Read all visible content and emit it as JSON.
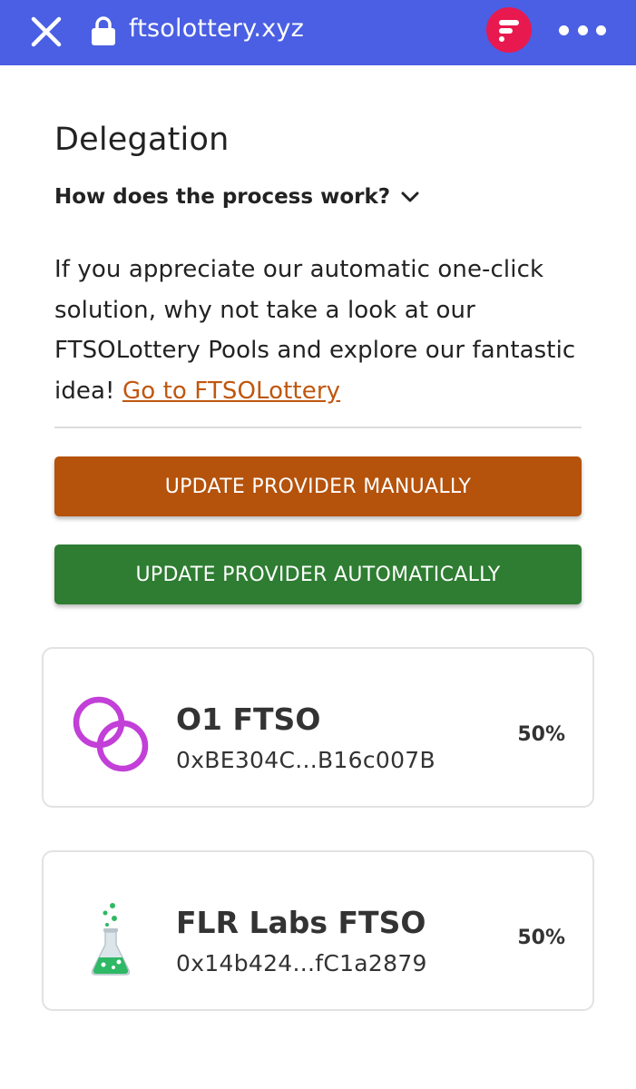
{
  "browser": {
    "url": "ftsolottery.xyz",
    "close_icon": "close-icon",
    "lock_icon": "lock-icon",
    "app_logo_icon": "flare-logo-icon",
    "more_icon": "more-dots-icon"
  },
  "page": {
    "title": "Delegation",
    "faq_label": "How does the process work?",
    "description": "If you appreciate our automatic one-click solution, why not take a look at our FTSOLottery Pools and explore our fantastic idea!",
    "link_text": "Go to FTSOLottery"
  },
  "buttons": {
    "manual_label": "UPDATE PROVIDER MANUALLY",
    "auto_label": "UPDATE PROVIDER AUTOMATICALLY"
  },
  "providers": [
    {
      "name": "O1 FTSO",
      "address": "0xBE304C...B16c007B",
      "share": "50%",
      "icon": "linked-rings-icon"
    },
    {
      "name": "FLR Labs FTSO",
      "address": "0x14b424...fC1a2879",
      "share": "50%",
      "icon": "flask-icon"
    }
  ],
  "colors": {
    "topbar": "#4a5fe3",
    "manual_button": "#b5520b",
    "auto_button": "#2e7d32",
    "link": "#c0570f",
    "logo": "#e8194e",
    "rings": "#c23fd8",
    "flask_liquid": "#2fb865"
  }
}
